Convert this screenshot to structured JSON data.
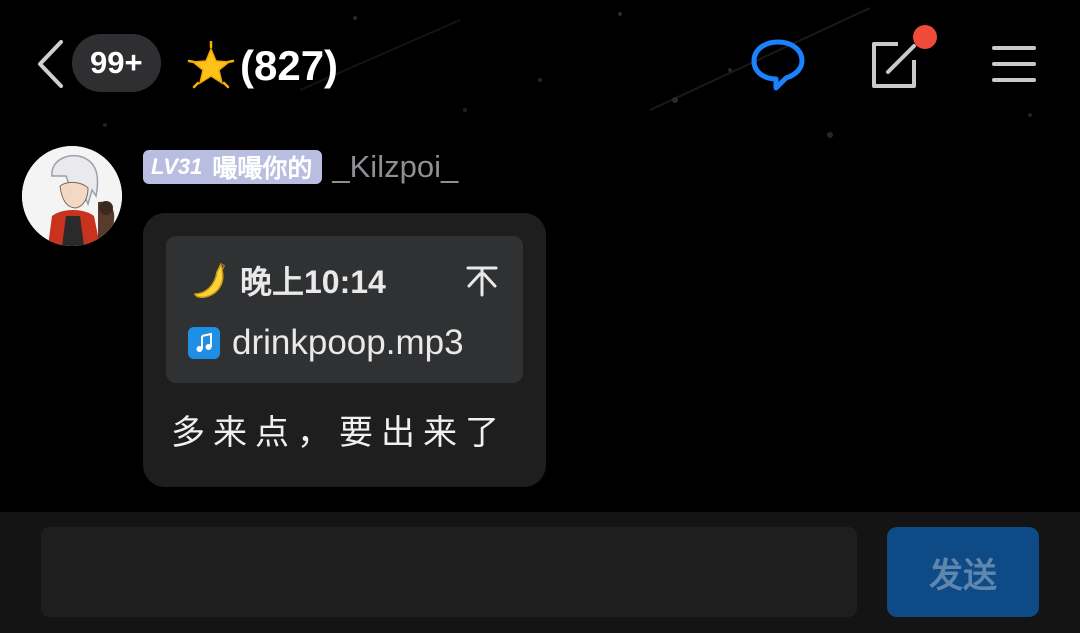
{
  "header": {
    "unread_count": "99+",
    "star_icon": "glowing-star-icon",
    "group_title": "(827)",
    "icons": [
      "back-chevron-icon",
      "chat-bubble-icon",
      "edit-icon",
      "menu-icon"
    ],
    "accent_color": "#1a82ff",
    "notification_dot_color": "#f04a3a"
  },
  "message": {
    "level": "LV31",
    "level_title": "嘬嘬你的",
    "level_badge_color": "#b9bde0",
    "sender": "_Kilzpoi_",
    "quote": {
      "emoji_icon": "banana-icon",
      "time": "晚上10:14",
      "file_icon": "music-file-icon",
      "file_name": "drinkpoop.mp3"
    },
    "text": "多来点，要出来了"
  },
  "input_bar": {
    "placeholder": "",
    "send_label": "发送",
    "send_color": "#0d4a86"
  }
}
